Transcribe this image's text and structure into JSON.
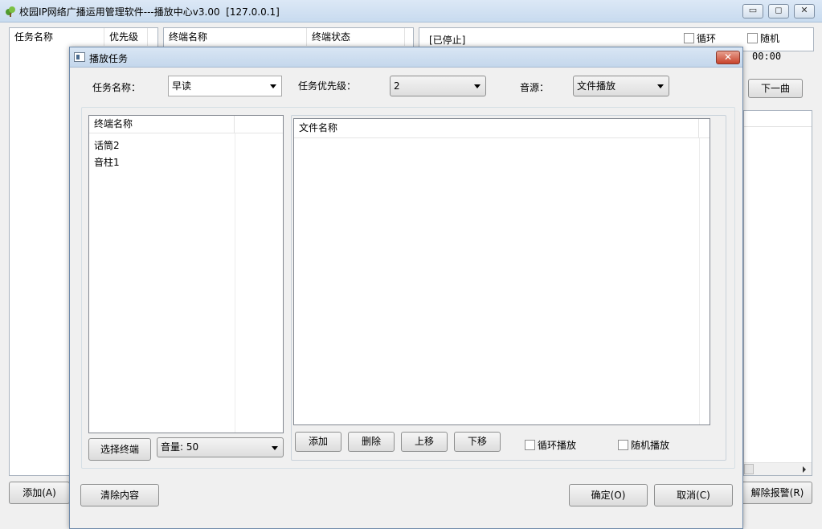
{
  "window": {
    "title": "校园IP网络广播运用管理软件---播放中心v3.00",
    "server_ip": "[127.0.0.1]",
    "controls": {
      "minimize": "▭",
      "maximize": "◻",
      "close": "✕"
    }
  },
  "main": {
    "task_list": {
      "col_name": "任务名称",
      "col_priority": "优先级"
    },
    "terminal_list": {
      "col_name": "终端名称",
      "col_status": "终端状态"
    },
    "player": {
      "status": "[已停止]",
      "loop_label": "循环",
      "random_label": "随机",
      "time": "00:00",
      "next_button": "下一曲"
    },
    "add_button": "添加(A)",
    "clear_alarm_button": "解除报警(R)"
  },
  "dialog": {
    "title": "播放任务",
    "close_label": "✕",
    "task_name_label": "任务名称：",
    "task_name_value": "早读",
    "priority_label": "任务优先级：",
    "priority_value": "2",
    "source_label": "音源：",
    "source_value": "文件播放",
    "terminal_list": {
      "header": "终端名称",
      "items": [
        "话筒2",
        "音柱1"
      ]
    },
    "select_terminal_button": "选择终端",
    "volume_value": "音量: 50",
    "file_list": {
      "header": "文件名称"
    },
    "file_buttons": {
      "add": "添加",
      "delete": "删除",
      "move_up": "上移",
      "move_down": "下移"
    },
    "loop_play_label": "循环播放",
    "random_play_label": "随机播放",
    "clear_button": "清除内容",
    "ok_button": "确定(O)",
    "cancel_button": "取消(C)"
  }
}
